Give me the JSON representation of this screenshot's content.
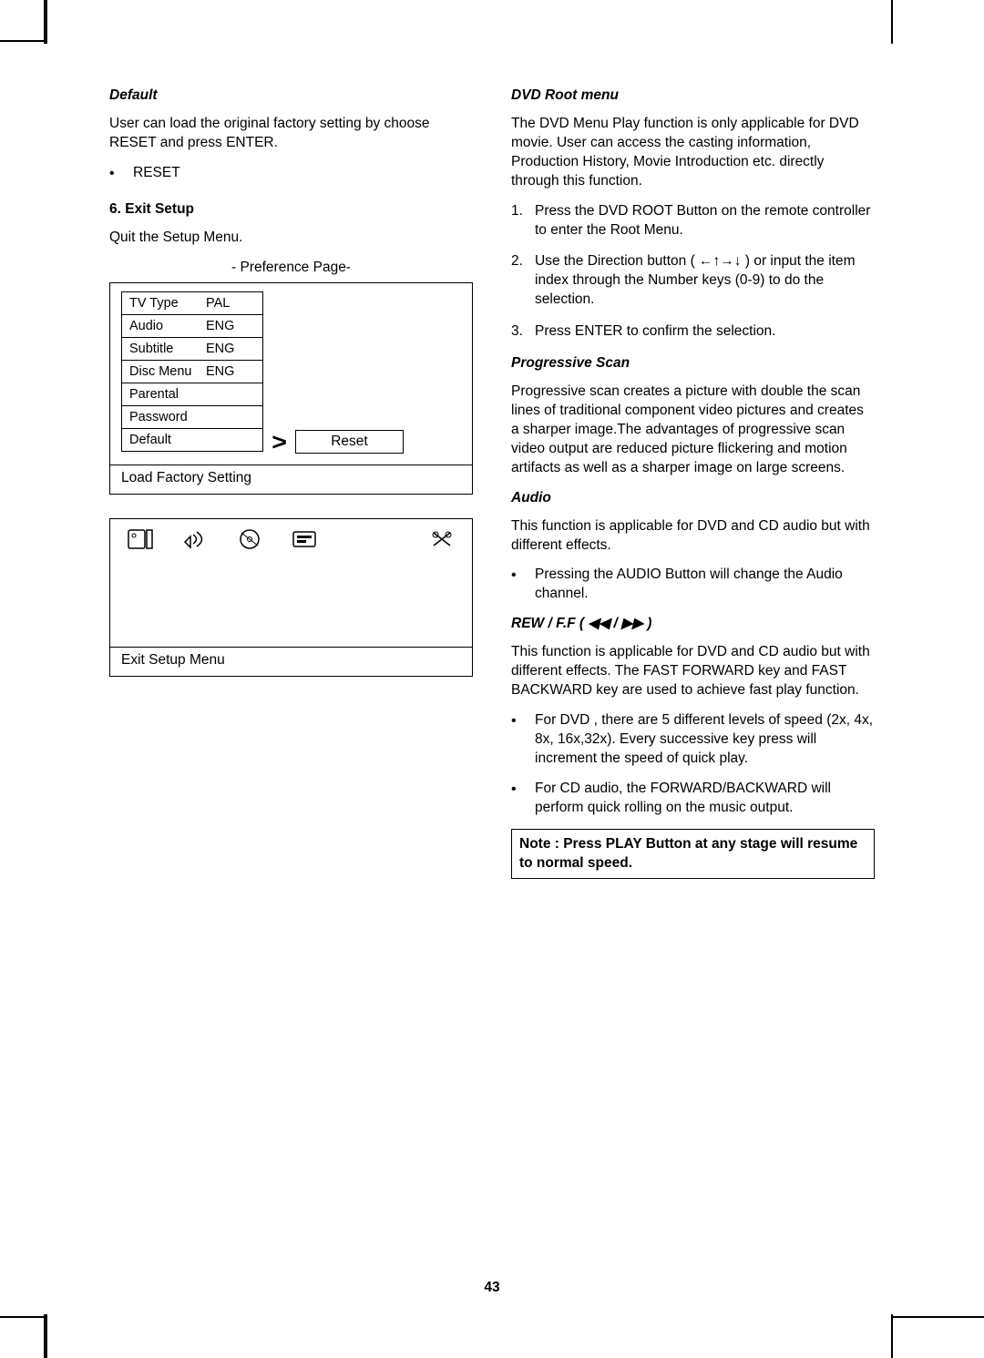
{
  "left": {
    "default_title": "Default",
    "default_body": "User can load the original factory setting by choose RESET and press ENTER.",
    "reset_item": "RESET",
    "exit_heading": "6. Exit Setup",
    "exit_body": "Quit the Setup Menu.",
    "osd_title": "- Preference Page-",
    "menu": [
      {
        "label": "TV Type",
        "value": "PAL"
      },
      {
        "label": "Audio",
        "value": "ENG"
      },
      {
        "label": "Subtitle",
        "value": "ENG"
      },
      {
        "label": "Disc Menu",
        "value": "ENG"
      },
      {
        "label": "Parental",
        "value": ""
      },
      {
        "label": "Password",
        "value": ""
      },
      {
        "label": "Default",
        "value": ""
      }
    ],
    "arrow_symbol": ">",
    "reset_label": "Reset",
    "osd_footer": "Load Factory Setting",
    "icons": [
      "file-icon",
      "audio-icon",
      "disc-icon",
      "subtitle-icon",
      "tools-icon"
    ],
    "iconbar_footer": "Exit Setup Menu"
  },
  "right": {
    "rootmenu_title": "DVD Root menu",
    "rootmenu_body": "The DVD Menu Play function is only applicable for DVD movie. User can access the casting information, Production History, Movie Introduction etc. directly through this function.",
    "root_steps": [
      "Press the DVD ROOT Button on the remote controller to enter the Root Menu.",
      "Use the Direction button ( ←↑→↓ ) or input the item index through the Number keys (0-9) to do the selection.",
      "Press ENTER to confirm the selection."
    ],
    "progscan_title": "Progressive Scan",
    "progscan_body": "Progressive scan creates a picture with double the scan lines of traditional component video pictures and creates a sharper image.The advantages of progressive scan video output are reduced picture flickering and motion artifacts as well as a sharper image on large screens.",
    "audio_title": "Audio",
    "audio_body": "This function is applicable for DVD and CD audio but with different effects.",
    "audio_bullet": "Pressing the AUDIO Button will change the Audio channel.",
    "rewff_title": "REW / F.F ( ◀◀ / ▶▶ )",
    "rewff_body": "This function is applicable for DVD and CD audio but with different effects. The FAST FORWARD key and FAST BACKWARD key are used to achieve fast play function.",
    "rewff_bullets": [
      "For DVD , there are 5 different levels of speed (2x, 4x, 8x, 16x,32x). Every successive key press will increment the speed of quick play.",
      "For CD audio, the FORWARD/BACKWARD will perform quick rolling on the music output."
    ],
    "note": "Note : Press PLAY Button at any stage will resume to normal speed."
  },
  "page_number": "43"
}
